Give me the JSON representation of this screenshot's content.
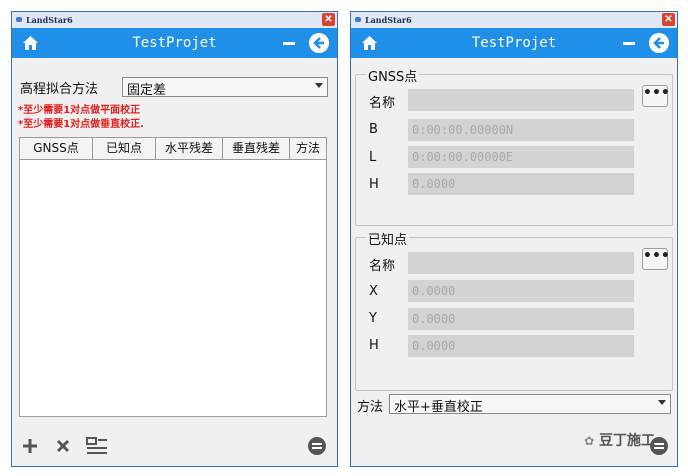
{
  "left_window": {
    "window_title": "LandStar6",
    "header_title": "TestProjet",
    "fit_method_label": "高程拟合方法",
    "fit_method_value": "固定差",
    "warnings": [
      "*至少需要1对点做平面校正",
      "*至少需要1对点做垂直校正."
    ],
    "table_columns": [
      "GNSS点",
      "已知点",
      "水平残差",
      "垂直残差",
      "方法"
    ]
  },
  "right_window": {
    "window_title": "LandStar6",
    "header_title": "TestProjet",
    "gnss_group": {
      "title": "GNSS点",
      "name_label": "名称",
      "b_label": "B",
      "b_value": "0:00:00.00000N",
      "l_label": "L",
      "l_value": "0:00:00.00000E",
      "h_label": "H",
      "h_value": "0.0000"
    },
    "known_group": {
      "title": "已知点",
      "name_label": "名称",
      "x_label": "X",
      "x_value": "0.0000",
      "y_label": "Y",
      "y_value": "0.0000",
      "h_label": "H",
      "h_value": "0.0000"
    },
    "method_label": "方法",
    "method_value": "水平+垂直校正"
  },
  "watermark_text": "豆丁施工",
  "colors": {
    "header_blue": "#1f8fe8",
    "warning_red": "#e01f1f",
    "close_red": "#d9442e"
  }
}
